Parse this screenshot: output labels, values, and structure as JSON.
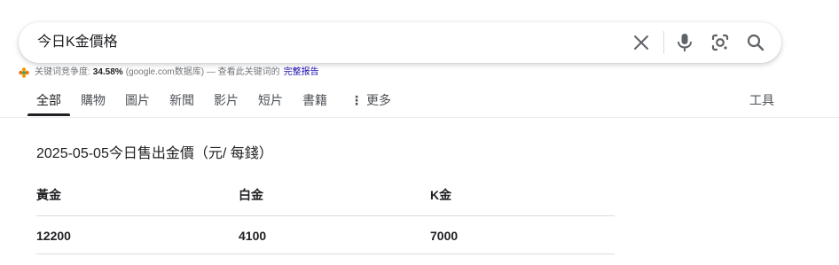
{
  "search": {
    "query": "今日K金價格"
  },
  "seo_bar": {
    "prefix": "关键词竞争度:",
    "value": "34.58%",
    "source": "(google.com数据库) — 查看此关键词的",
    "link": "完整报告"
  },
  "tabs": [
    {
      "label": "全部"
    },
    {
      "label": "購物"
    },
    {
      "label": "圖片"
    },
    {
      "label": "新聞"
    },
    {
      "label": "影片"
    },
    {
      "label": "短片"
    },
    {
      "label": "書籍"
    },
    {
      "label": "更多"
    }
  ],
  "tools_label": "工具",
  "result": {
    "title": "2025-05-05今日售出金價（元/ 每錢）",
    "headers": [
      "黃金",
      "白金",
      "K金"
    ],
    "row": [
      "12200",
      "4100",
      "7000"
    ]
  },
  "colors": {
    "text": "#202124",
    "muted": "#4d5156",
    "link": "#1a0dab",
    "divider": "#dadce0"
  },
  "icons": [
    "close-icon",
    "microphone-icon",
    "lens-icon",
    "search-icon",
    "seo-flower-icon",
    "more-vert-icon"
  ]
}
